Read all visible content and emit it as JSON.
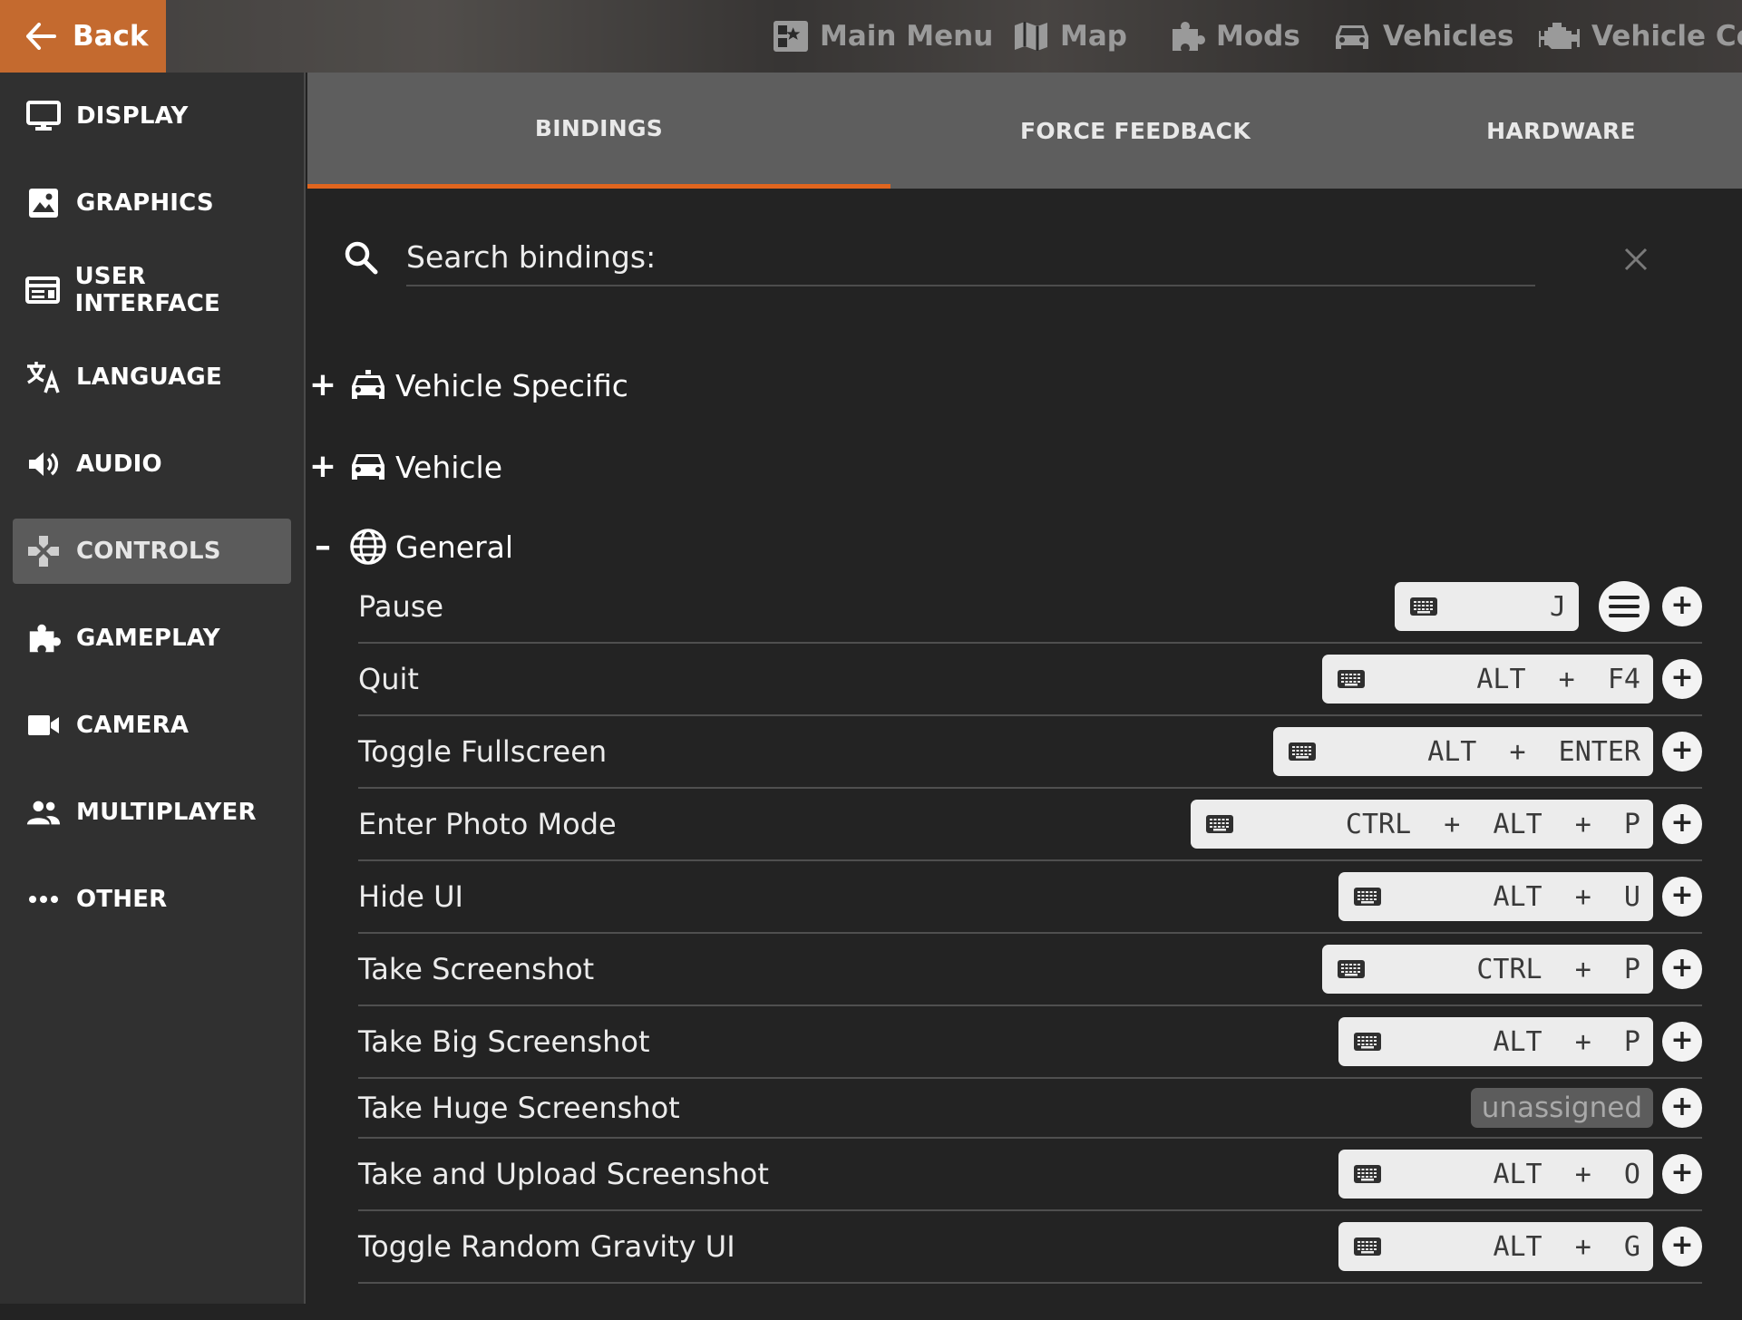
{
  "topbar": {
    "back_label": "Back",
    "nav": [
      {
        "label": "Main Menu",
        "icon": "main-menu-icon"
      },
      {
        "label": "Map",
        "icon": "map-icon"
      },
      {
        "label": "Mods",
        "icon": "puzzle-icon"
      },
      {
        "label": "Vehicles",
        "icon": "car-icon"
      },
      {
        "label": "Vehicle Con",
        "icon": "engine-icon"
      }
    ]
  },
  "sidebar": {
    "items": [
      {
        "label": "DISPLAY",
        "icon": "monitor-icon"
      },
      {
        "label": "GRAPHICS",
        "icon": "image-icon"
      },
      {
        "label": "USER INTERFACE",
        "icon": "user-interface-icon"
      },
      {
        "label": "LANGUAGE",
        "icon": "translate-icon"
      },
      {
        "label": "AUDIO",
        "icon": "speaker-icon"
      },
      {
        "label": "CONTROLS",
        "icon": "gamepad-icon",
        "active": true
      },
      {
        "label": "GAMEPLAY",
        "icon": "puzzle-icon"
      },
      {
        "label": "CAMERA",
        "icon": "video-camera-icon"
      },
      {
        "label": "MULTIPLAYER",
        "icon": "people-icon"
      },
      {
        "label": "OTHER",
        "icon": "more-dots-icon"
      }
    ]
  },
  "tabs": [
    {
      "label": "BINDINGS",
      "active": true
    },
    {
      "label": "FORCE FEEDBACK"
    },
    {
      "label": "HARDWARE"
    }
  ],
  "search": {
    "placeholder": "Search bindings:",
    "value": ""
  },
  "categories": [
    {
      "label": "Vehicle Specific",
      "toggle": "+",
      "icon": "car-icon"
    },
    {
      "label": "Vehicle",
      "toggle": "+",
      "icon": "car-icon"
    },
    {
      "label": "General",
      "toggle": "–",
      "icon": "globe-icon"
    }
  ],
  "bindings": [
    {
      "name": "Pause",
      "key": "J",
      "extra_device": "menu-icon"
    },
    {
      "name": "Quit",
      "key": "ALT + F4"
    },
    {
      "name": "Toggle Fullscreen",
      "key": "ALT + ENTER"
    },
    {
      "name": "Enter Photo Mode",
      "key": "CTRL + ALT + P"
    },
    {
      "name": "Hide UI",
      "key": "ALT + U"
    },
    {
      "name": "Take Screenshot",
      "key": "CTRL + P"
    },
    {
      "name": "Take Big Screenshot",
      "key": "ALT + P"
    },
    {
      "name": "Take Huge Screenshot",
      "key": "unassigned"
    },
    {
      "name": "Take and Upload Screenshot",
      "key": "ALT + O"
    },
    {
      "name": "Toggle Random Gravity UI",
      "key": "ALT + G"
    }
  ],
  "colors": {
    "accent": "#e0651e",
    "back_button": "#c46a2f",
    "sidebar_bg": "#303030",
    "content_bg": "#232323",
    "tab_bar_bg": "#5e5e5e"
  }
}
